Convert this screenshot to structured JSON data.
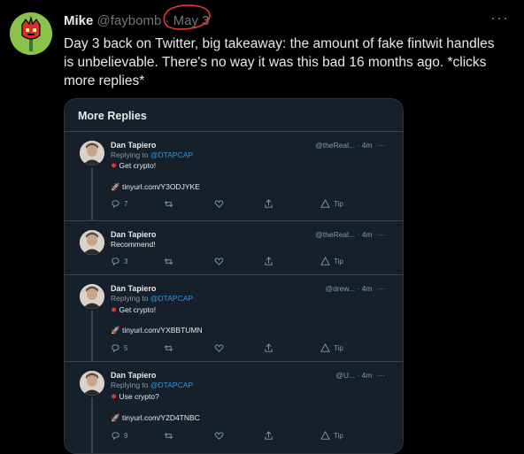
{
  "tweet": {
    "name": "Mike",
    "handle": "@faybomb",
    "separator": "·",
    "date": "May 3",
    "more": "···",
    "text": "Day 3 back on Twitter, big takeaway: the amount of fake fintwit handles is unbelievable. There's no way it was this bad 16 months ago. *clicks more replies*"
  },
  "card": {
    "title": "More Replies",
    "replies": [
      {
        "name": "Dan Tapiero",
        "meta": "@theReal... · 4m",
        "dots": "···",
        "replying_prefix": "Replying to",
        "replying_handle": "@DTAPCAP",
        "body": "Get crypto!",
        "link": "tinyurl.com/Y3ODJYKE",
        "reply_count": "7",
        "tip": "Tip"
      },
      {
        "name": "Dan Tapiero",
        "meta": "@theReal... · 4m",
        "dots": "···",
        "body": "Recommend!",
        "reply_count": "3",
        "tip": "Tip"
      },
      {
        "name": "Dan Tapiero",
        "meta": "@drew... · 4m",
        "dots": "···",
        "replying_prefix": "Replying to",
        "replying_handle": "@DTAPCAP",
        "body": "Get crypto!",
        "link": "tinyurl.com/YXBBTUMN",
        "reply_count": "5",
        "tip": "Tip"
      },
      {
        "name": "Dan Tapiero",
        "meta": "@U... · 4m",
        "dots": "···",
        "replying_prefix": "Replying to",
        "replying_handle": "@DTAPCAP",
        "body": "Use crypto?",
        "link": "tinyurl.com/Y2D4TNBC",
        "reply_count": "9",
        "tip": "Tip"
      }
    ]
  },
  "colors": {
    "accent": "#1d9bf0",
    "annotation": "#e53935",
    "card_bg": "#15202b"
  }
}
